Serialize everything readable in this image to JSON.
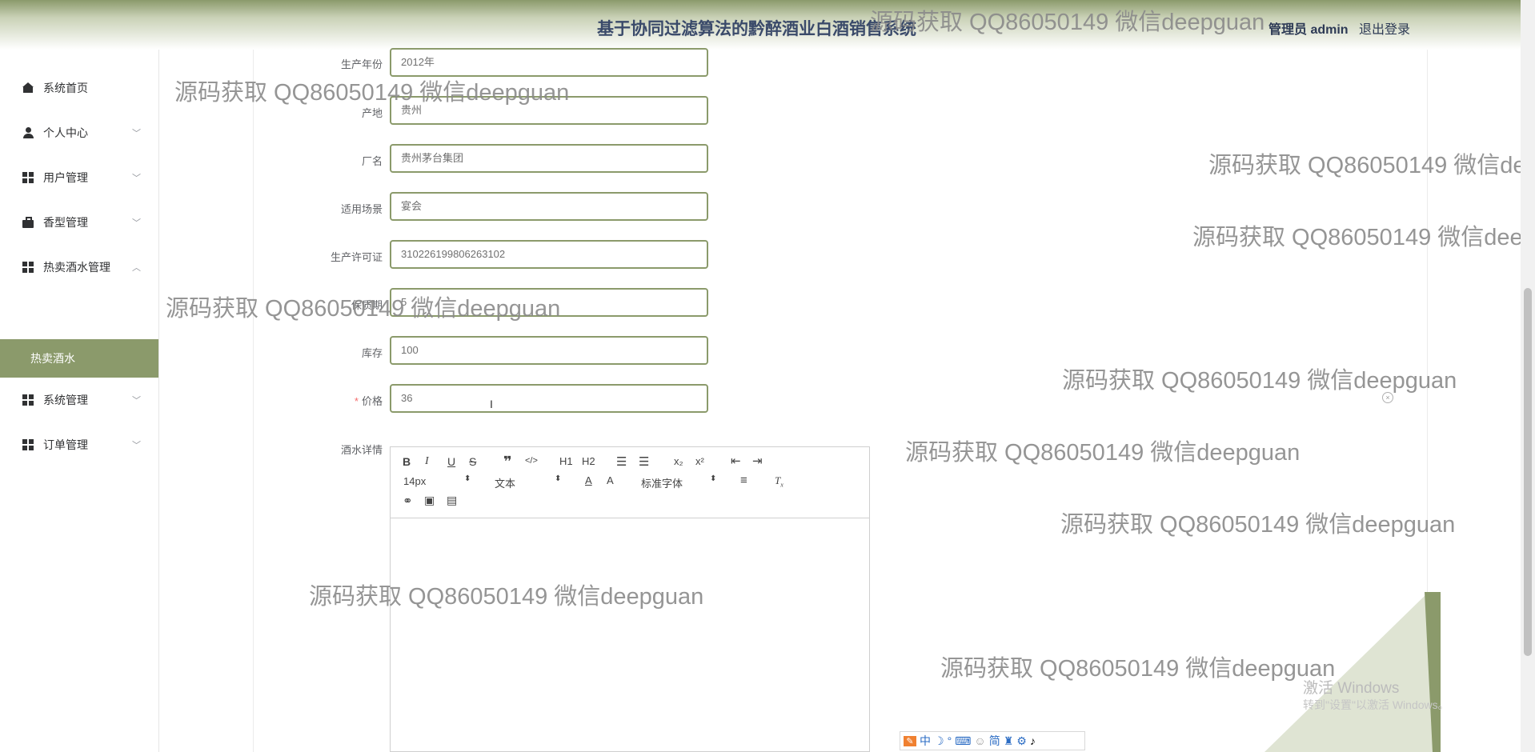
{
  "header": {
    "title": "基于协同过滤算法的黔醉酒业白酒销售系统",
    "user": "管理员 admin",
    "logout": "退出登录"
  },
  "sidebar": {
    "items": [
      {
        "label": "系统首页",
        "icon": "home-icon"
      },
      {
        "label": "个人中心",
        "icon": "user-icon"
      },
      {
        "label": "用户管理",
        "icon": "grid-icon"
      },
      {
        "label": "香型管理",
        "icon": "briefcase-icon"
      },
      {
        "label": "热卖酒水管理",
        "icon": "grid-icon"
      },
      {
        "label": "热卖酒水",
        "icon": ""
      },
      {
        "label": "系统管理",
        "icon": "grid-icon"
      },
      {
        "label": "订单管理",
        "icon": "grid-icon"
      }
    ]
  },
  "form": {
    "fields": [
      {
        "label": "生产年份",
        "value": "2012年"
      },
      {
        "label": "产地",
        "value": "贵州"
      },
      {
        "label": "厂名",
        "value": "贵州茅台集团"
      },
      {
        "label": "适用场景",
        "value": "宴会"
      },
      {
        "label": "生产许可证",
        "value": "310226199806263102"
      },
      {
        "label": "保质期",
        "value": "5"
      },
      {
        "label": "库存",
        "value": "100"
      },
      {
        "label": "价格",
        "value": "36",
        "required_mark": "*"
      }
    ],
    "detail_label": "酒水详情"
  },
  "editor": {
    "font_size": "14px",
    "paragraph": "文本",
    "font_family": "标准字体",
    "buttons": [
      "B",
      "I",
      "U",
      "S",
      "❞",
      "</>",
      "H1",
      "H2",
      "ol",
      "ul",
      "x₂",
      "x²",
      "outdent",
      "indent",
      "color",
      "background",
      "align",
      "clear",
      "link",
      "image",
      "video"
    ]
  },
  "watermark": "源码获取 QQ86050149 微信deepguan",
  "windows": {
    "activate_title": "激活 Windows",
    "activate_sub": "转到\"设置\"以激活 Windows。"
  },
  "ime": {
    "items": [
      "中",
      "简"
    ]
  },
  "colors": {
    "accent": "#8b9a6b",
    "header_text": "#3a4a6a",
    "required": "#f56c6c"
  }
}
